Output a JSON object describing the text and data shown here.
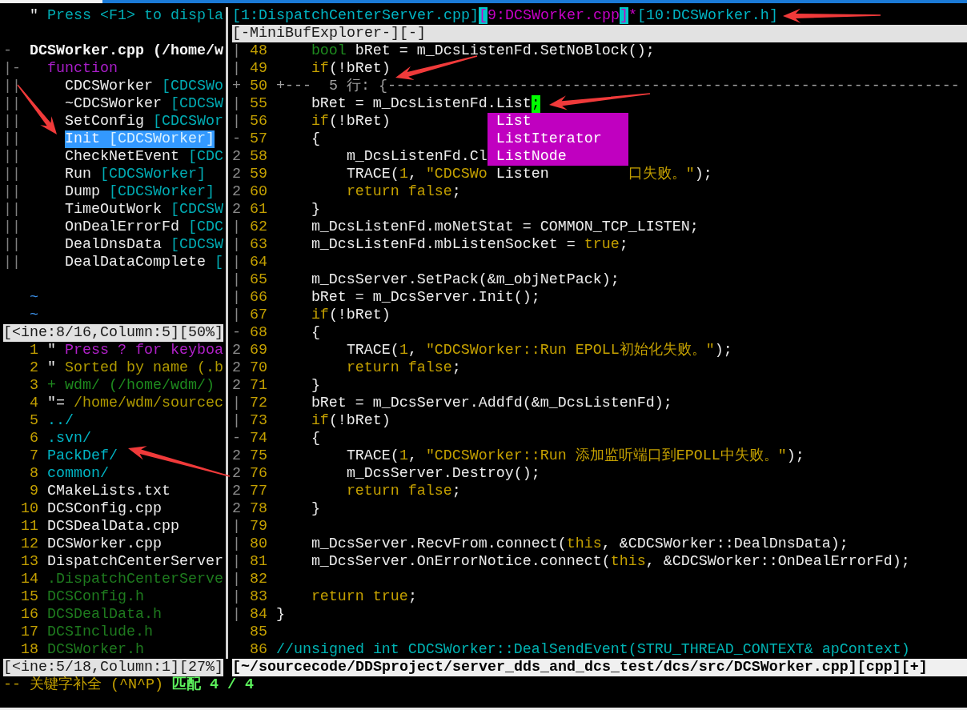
{
  "tagbar": {
    "help": {
      "prefix": "\"",
      "text": "Press <F1> to displa"
    },
    "tree": [
      {
        "fold": "-",
        "label": "DCSWorker.cpp (/home/w",
        "children": [
          {
            "fold": "|-",
            "label": "function",
            "children": [
              {
                "fold": "||",
                "name": "CDCSWorker",
                "scope": "[CDCSWo",
                "selected": false
              },
              {
                "fold": "||",
                "name": "~CDCSWorker",
                "scope": "[CDCSW",
                "selected": false
              },
              {
                "fold": "||",
                "name": "SetConfig",
                "scope": "[CDCSWor",
                "selected": false
              },
              {
                "fold": "||",
                "name": "Init",
                "scope": "[CDCSWorker]",
                "selected": true
              },
              {
                "fold": "||",
                "name": "CheckNetEvent",
                "scope": "[CDC",
                "selected": false
              },
              {
                "fold": "||",
                "name": "Run",
                "scope": "[CDCSWorker]",
                "selected": false
              },
              {
                "fold": "||",
                "name": "Dump",
                "scope": "[CDCSWorker]",
                "selected": false
              },
              {
                "fold": "||",
                "name": "TimeOutWork",
                "scope": "[CDCSW",
                "selected": false
              },
              {
                "fold": "||",
                "name": "OnDealErrorFd",
                "scope": "[CDC",
                "selected": false
              },
              {
                "fold": "||",
                "name": "DealDnsData",
                "scope": "[CDCSW",
                "selected": false
              },
              {
                "fold": "||",
                "name": "DealDataComplete",
                "scope": "[",
                "selected": false
              }
            ]
          }
        ]
      }
    ],
    "filler": [
      "~",
      "~"
    ],
    "status": {
      "text": "[<ine:8/16,Column:5][50%]",
      "active": false
    }
  },
  "file_tree": {
    "lines": [
      {
        "number": "1",
        "kind": "help",
        "prefix": "\"",
        "text": "Press ? for keyboa"
      },
      {
        "number": "2",
        "kind": "info",
        "prefix": "\"",
        "text": "Sorted by name (.b"
      },
      {
        "number": "3",
        "kind": "parent",
        "text": "+ wdm/ (/home/wdm/)"
      },
      {
        "number": "4",
        "kind": "info",
        "prefix": "\"=",
        "text": "/home/wdm/sourcec"
      },
      {
        "number": "5",
        "kind": "directory",
        "text": "../"
      },
      {
        "number": "6",
        "kind": "directory",
        "text": ".svn/"
      },
      {
        "number": "7",
        "kind": "directory",
        "text": "PackDef/"
      },
      {
        "number": "8",
        "kind": "directory",
        "text": "common/"
      },
      {
        "number": "9",
        "kind": "file",
        "text": "CMakeLists.txt"
      },
      {
        "number": "10",
        "kind": "file",
        "text": "DCSConfig.cpp"
      },
      {
        "number": "11",
        "kind": "file",
        "text": "DCSDealData.cpp"
      },
      {
        "number": "12",
        "kind": "file",
        "text": "DCSWorker.cpp"
      },
      {
        "number": "13",
        "kind": "file",
        "text": "DispatchCenterServer"
      },
      {
        "number": "14",
        "kind": "secondary",
        "text": ".DispatchCenterServe"
      },
      {
        "number": "15",
        "kind": "secondary",
        "text": "DCSConfig.h"
      },
      {
        "number": "16",
        "kind": "secondary",
        "text": "DCSDealData.h"
      },
      {
        "number": "17",
        "kind": "secondary",
        "text": "DCSInclude.h"
      },
      {
        "number": "18",
        "kind": "secondary",
        "text": "DCSWorker.h"
      }
    ],
    "status": {
      "text": "[<ine:5/18,Column:1][27%]",
      "active": false
    }
  },
  "minibuf": {
    "tabs": [
      {
        "open": "[",
        "label": "1:DispatchCenterServer.cpp",
        "close": "]",
        "selected": false
      },
      {
        "open": "[",
        "label": "9:DCSWorker.cpp",
        "close": "]",
        "selected": true,
        "marker": "*"
      },
      {
        "open": "[",
        "label": "10:DCSWorker.h",
        "close": "]",
        "selected": false
      }
    ],
    "status": {
      "text": "[-MiniBufExplorer-][-]",
      "active": false
    }
  },
  "editor": {
    "lines": [
      {
        "kind": "code",
        "fold": "|",
        "number": "48",
        "tokens": [
          {
            "kind": "type",
            "text": "    bool"
          },
          {
            "kind": "text",
            "text": " bRet = m_DcsListenFd.SetNoBlock();"
          }
        ]
      },
      {
        "kind": "code",
        "fold": "|",
        "number": "49",
        "tokens": [
          {
            "kind": "keyword",
            "text": "    if"
          },
          {
            "kind": "text",
            "text": "(!bRet)"
          }
        ]
      },
      {
        "kind": "fold",
        "fold": "+",
        "number": "50",
        "text": "+---  5 行: {-----------------------------------------------------------------"
      },
      {
        "kind": "code",
        "fold": "|",
        "number": "55",
        "tokens": [
          {
            "kind": "text",
            "text": "    bRet = m_DcsListenFd."
          },
          {
            "kind": "completion",
            "text": "List"
          },
          {
            "kind": "cursor",
            "text": ";"
          }
        ]
      },
      {
        "kind": "code",
        "fold": "|",
        "number": "56",
        "tokens": [
          {
            "kind": "keyword",
            "text": "    if"
          },
          {
            "kind": "text",
            "text": "(!bRet)"
          }
        ]
      },
      {
        "kind": "code",
        "fold": "-",
        "number": "57",
        "tokens": [
          {
            "kind": "text",
            "text": "    {"
          }
        ]
      },
      {
        "kind": "code",
        "fold": "2",
        "number": "58",
        "tokens": [
          {
            "kind": "text",
            "text": "        m_DcsListenFd.Cl"
          }
        ]
      },
      {
        "kind": "code",
        "fold": "2",
        "number": "59",
        "tokens": [
          {
            "kind": "text",
            "text": "        TRACE("
          },
          {
            "kind": "number",
            "text": "1"
          },
          {
            "kind": "text",
            "text": ", "
          },
          {
            "kind": "string",
            "text": "\"CDCSWo"
          }
        ],
        "after_popup": [
          {
            "kind": "string",
            "text": "口失败。\""
          },
          {
            "kind": "text",
            "text": ");"
          }
        ]
      },
      {
        "kind": "code",
        "fold": "2",
        "number": "60",
        "tokens": [
          {
            "kind": "keyword",
            "text": "        return false"
          },
          {
            "kind": "text",
            "text": ";"
          }
        ]
      },
      {
        "kind": "code",
        "fold": "2",
        "number": "61",
        "tokens": [
          {
            "kind": "text",
            "text": "    }"
          }
        ]
      },
      {
        "kind": "code",
        "fold": "|",
        "number": "62",
        "tokens": [
          {
            "kind": "text",
            "text": "    m_DcsListenFd.moNetStat = COMMON_TCP_LISTEN;"
          }
        ]
      },
      {
        "kind": "code",
        "fold": "|",
        "number": "63",
        "tokens": [
          {
            "kind": "text",
            "text": "    m_DcsListenFd.mbListenSocket = "
          },
          {
            "kind": "keyword",
            "text": "true"
          },
          {
            "kind": "text",
            "text": ";"
          }
        ]
      },
      {
        "kind": "code",
        "fold": "|",
        "number": "64"
      },
      {
        "kind": "code",
        "fold": "|",
        "number": "65",
        "tokens": [
          {
            "kind": "text",
            "text": "    m_DcsServer.SetPack(&m_objNetPack);"
          }
        ]
      },
      {
        "kind": "code",
        "fold": "|",
        "number": "66",
        "tokens": [
          {
            "kind": "text",
            "text": "    bRet = m_DcsServer.Init();"
          }
        ]
      },
      {
        "kind": "code",
        "fold": "|",
        "number": "67",
        "tokens": [
          {
            "kind": "keyword",
            "text": "    if"
          },
          {
            "kind": "text",
            "text": "(!bRet)"
          }
        ]
      },
      {
        "kind": "code",
        "fold": "-",
        "number": "68",
        "tokens": [
          {
            "kind": "text",
            "text": "    {"
          }
        ]
      },
      {
        "kind": "code",
        "fold": "2",
        "number": "69",
        "tokens": [
          {
            "kind": "text",
            "text": "        TRACE("
          },
          {
            "kind": "number",
            "text": "1"
          },
          {
            "kind": "text",
            "text": ", "
          },
          {
            "kind": "string",
            "text": "\"CDCSWorker::Run EPOLL初始化失败。\""
          },
          {
            "kind": "text",
            "text": ");"
          }
        ]
      },
      {
        "kind": "code",
        "fold": "2",
        "number": "70",
        "tokens": [
          {
            "kind": "keyword",
            "text": "        return false"
          },
          {
            "kind": "text",
            "text": ";"
          }
        ]
      },
      {
        "kind": "code",
        "fold": "2",
        "number": "71",
        "tokens": [
          {
            "kind": "text",
            "text": "    }"
          }
        ]
      },
      {
        "kind": "code",
        "fold": "|",
        "number": "72",
        "tokens": [
          {
            "kind": "text",
            "text": "    bRet = m_DcsServer.Addfd(&m_DcsListenFd);"
          }
        ]
      },
      {
        "kind": "code",
        "fold": "|",
        "number": "73",
        "tokens": [
          {
            "kind": "keyword",
            "text": "    if"
          },
          {
            "kind": "text",
            "text": "(!bRet)"
          }
        ]
      },
      {
        "kind": "code",
        "fold": "-",
        "number": "74",
        "tokens": [
          {
            "kind": "text",
            "text": "    {"
          }
        ]
      },
      {
        "kind": "code",
        "fold": "2",
        "number": "75",
        "tokens": [
          {
            "kind": "text",
            "text": "        TRACE("
          },
          {
            "kind": "number",
            "text": "1"
          },
          {
            "kind": "text",
            "text": ", "
          },
          {
            "kind": "string",
            "text": "\"CDCSWorker::Run 添加监听端口到EPOLL中失败。\""
          },
          {
            "kind": "text",
            "text": ");"
          }
        ]
      },
      {
        "kind": "code",
        "fold": "2",
        "number": "76",
        "tokens": [
          {
            "kind": "text",
            "text": "        m_DcsServer.Destroy();"
          }
        ]
      },
      {
        "kind": "code",
        "fold": "2",
        "number": "77",
        "tokens": [
          {
            "kind": "keyword",
            "text": "        return false"
          },
          {
            "kind": "text",
            "text": ";"
          }
        ]
      },
      {
        "kind": "code",
        "fold": "2",
        "number": "78",
        "tokens": [
          {
            "kind": "text",
            "text": "    }"
          }
        ]
      },
      {
        "kind": "code",
        "fold": "|",
        "number": "79"
      },
      {
        "kind": "code",
        "fold": "|",
        "number": "80",
        "tokens": [
          {
            "kind": "text",
            "text": "    m_DcsServer.RecvFrom.connect("
          },
          {
            "kind": "keyword",
            "text": "this"
          },
          {
            "kind": "text",
            "text": ", &CDCSWorker::DealDnsData);"
          }
        ]
      },
      {
        "kind": "code",
        "fold": "|",
        "number": "81",
        "tokens": [
          {
            "kind": "text",
            "text": "    m_DcsServer.OnErrorNotice.connect("
          },
          {
            "kind": "keyword",
            "text": "this"
          },
          {
            "kind": "text",
            "text": ", &CDCSWorker::OnDealErrorFd);"
          }
        ]
      },
      {
        "kind": "code",
        "fold": "|",
        "number": "82"
      },
      {
        "kind": "code",
        "fold": "|",
        "number": "83",
        "tokens": [
          {
            "kind": "keyword",
            "text": "    return true"
          },
          {
            "kind": "text",
            "text": ";"
          }
        ]
      },
      {
        "kind": "code",
        "fold": "|",
        "number": "84",
        "tokens": [
          {
            "kind": "text",
            "text": "}"
          }
        ]
      },
      {
        "kind": "code",
        "number": "85"
      },
      {
        "kind": "code",
        "number": "86",
        "tokens": [
          {
            "kind": "comment",
            "text": "//unsigned int CDCSWorker::DealSendEvent(STRU_THREAD_CONTEXT& apContext)"
          }
        ]
      }
    ],
    "popup": {
      "items": [
        {
          "label": "List",
          "selected": false
        },
        {
          "label": "ListIterator",
          "selected": false
        },
        {
          "label": "ListNode",
          "selected": false
        },
        {
          "label": "Listen",
          "selected": true
        }
      ]
    },
    "status": {
      "text": "[~/sourcecode/DDSproject/server_dds_and_dcs_test/dcs/src/DCSWorker.cpp][cpp][+]",
      "active": true
    }
  },
  "command_line": {
    "mode": "-- 关键字补全 (^N^P)",
    "match": "匹配 4 / 4"
  }
}
